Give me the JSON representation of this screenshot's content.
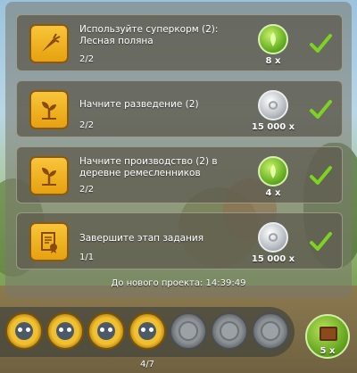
{
  "quests": [
    {
      "title": "Используйте суперкорм (2): Лесная поляна",
      "progress": "2/2",
      "reward_amount": "8 x",
      "reward_type": "green-resource",
      "icon": "carrot-icon"
    },
    {
      "title": "Начните разведение (2)",
      "progress": "2/2",
      "reward_amount": "15 000 x",
      "reward_type": "silver-coin",
      "icon": "sprout-icon"
    },
    {
      "title": "Начните производство (2) в деревне ремесленников",
      "progress": "2/2",
      "reward_amount": "4 x",
      "reward_type": "green-resource",
      "icon": "sprout-icon"
    },
    {
      "title": "Завершите этап задания",
      "progress": "1/1",
      "reward_amount": "15 000 x",
      "reward_type": "silver-coin",
      "icon": "certificate-icon"
    }
  ],
  "timer_text": "До нового проекта: 14:39:49",
  "pager_text": "4/7",
  "chest_amount": "5 x",
  "colors": {
    "icon_gold": "#f0b020",
    "check_green": "#7ed321",
    "reward_green": "#5aa81a"
  }
}
